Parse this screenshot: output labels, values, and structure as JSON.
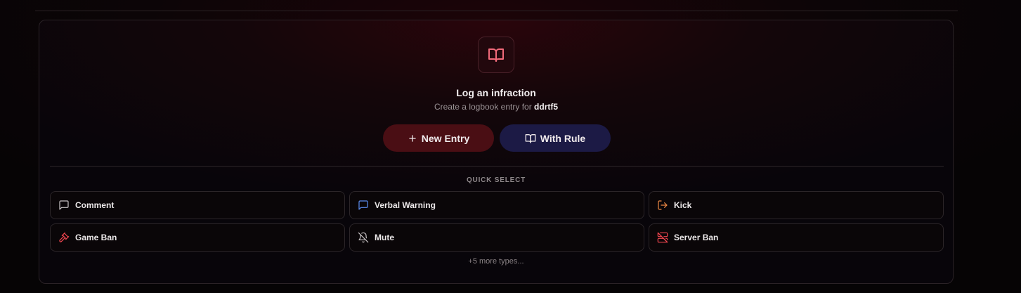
{
  "header": {
    "title": "Log an infraction",
    "subtitle_prefix": "Create a logbook entry for",
    "username": "ddrtf5",
    "icon": "book-open-icon"
  },
  "actions": {
    "new_entry_label": "New Entry",
    "with_rule_label": "With Rule"
  },
  "quick_select": {
    "label": "QUICK SELECT",
    "items": [
      {
        "label": "Comment",
        "icon": "message-square-icon",
        "color": "#c8c3c5"
      },
      {
        "label": "Verbal Warning",
        "icon": "message-square-icon",
        "color": "#5b8df0"
      },
      {
        "label": "Kick",
        "icon": "log-out-icon",
        "color": "#f08a44"
      },
      {
        "label": "Game Ban",
        "icon": "gavel-icon",
        "color": "#f0454f"
      },
      {
        "label": "Mute",
        "icon": "bell-off-icon",
        "color": "#c8c3c5"
      },
      {
        "label": "Server Ban",
        "icon": "server-off-icon",
        "color": "#f0454f"
      }
    ],
    "more_label": "+5 more types..."
  },
  "colors": {
    "accent_red": "#f06a7a",
    "new_entry_bg": "#4a0e14",
    "with_rule_bg": "#1c1a45"
  }
}
